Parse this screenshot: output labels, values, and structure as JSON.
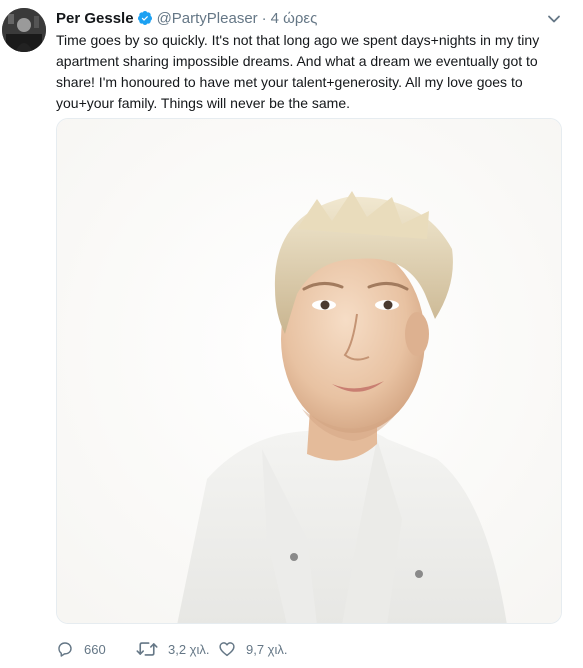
{
  "user": {
    "display_name": "Per Gessle",
    "handle": "@PartyPleaser",
    "separator": "·",
    "time": "4 ώρες"
  },
  "tweet": {
    "text": "Time goes by so quickly. It's not that long ago we spent days+nights in my tiny apartment sharing impossible dreams. And what a dream we eventually got to share! I'm honoured to have met your talent+generosity. All my love goes to you+your family. Things will never be the same."
  },
  "actions": {
    "replies": "660",
    "retweets": "3,2 χιλ.",
    "likes": "9,7 χιλ."
  },
  "colors": {
    "text": "#14171a",
    "secondary": "#657786",
    "verified": "#1da1f2",
    "border": "#e6ecf0"
  },
  "icons": {
    "verified": "verified-badge-icon",
    "caret": "chevron-down-icon",
    "reply": "reply-icon",
    "retweet": "retweet-icon",
    "like": "heart-icon"
  }
}
